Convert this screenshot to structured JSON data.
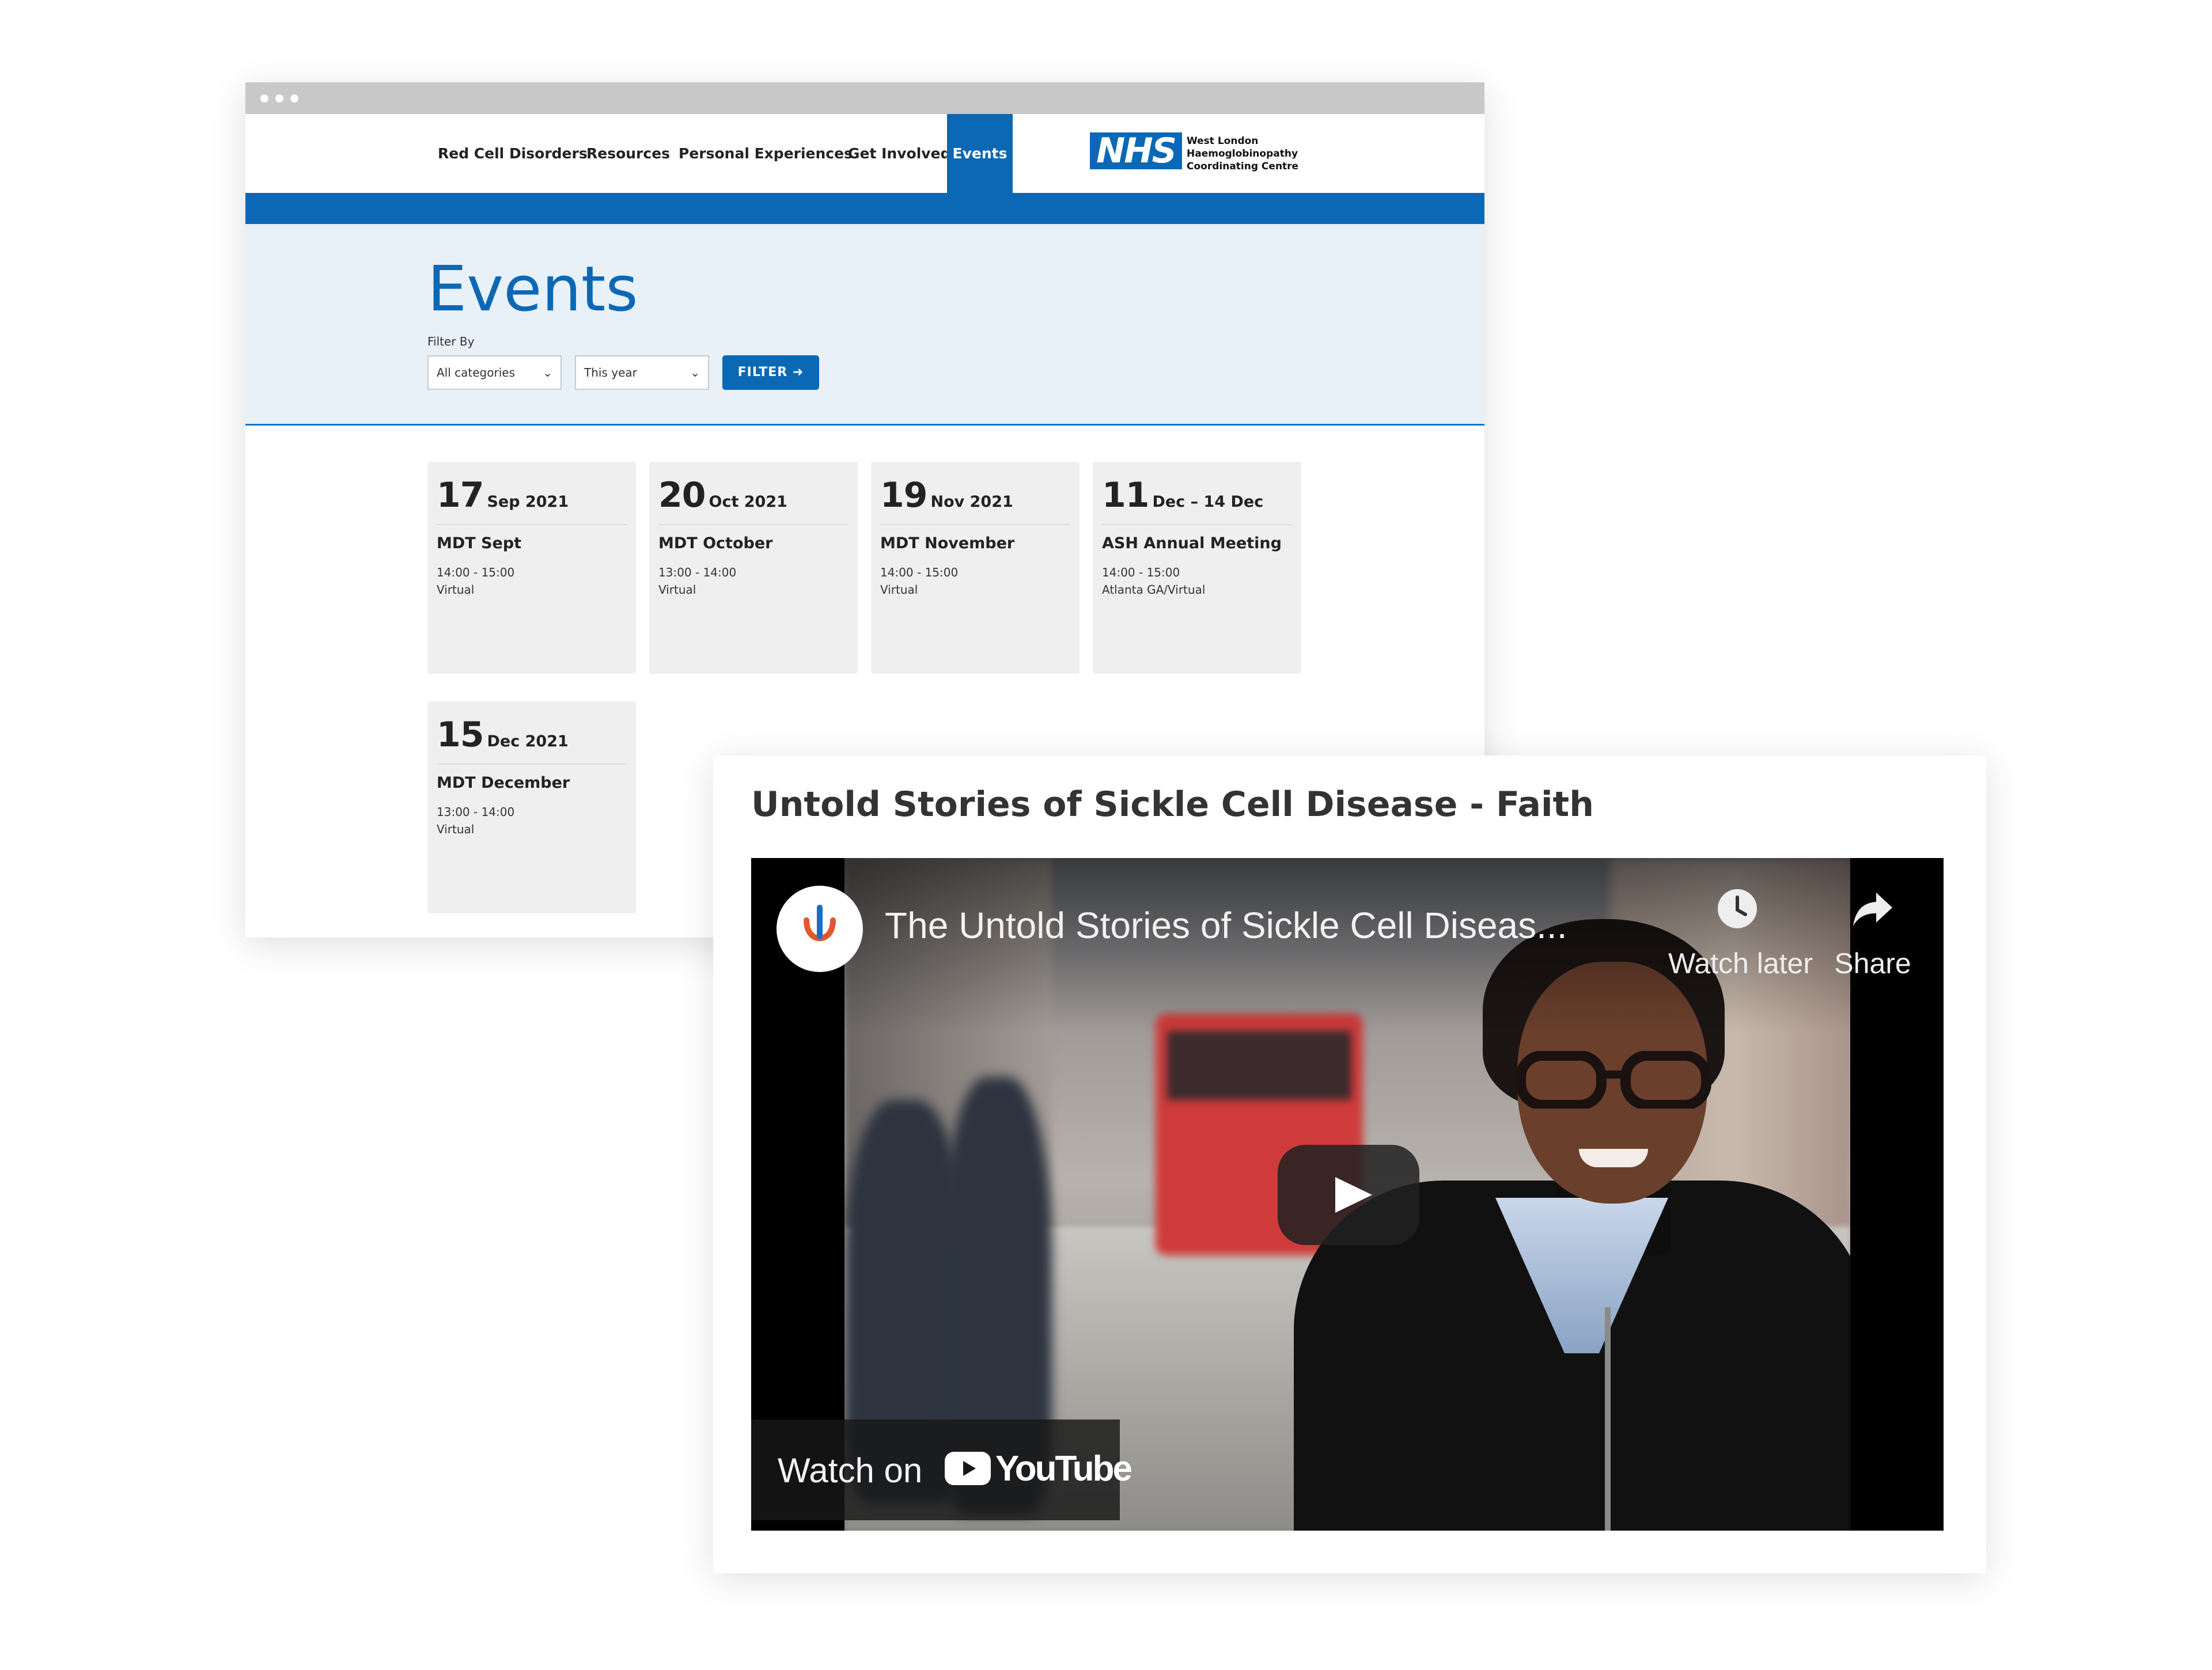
{
  "nav": {
    "items": [
      {
        "label": "Red Cell Disorders"
      },
      {
        "label": "Resources"
      },
      {
        "label": "Personal Experiences"
      },
      {
        "label": "Get Involved"
      },
      {
        "label": "Events",
        "active": true
      }
    ],
    "logo_text": "NHS",
    "org_lines": [
      "West London",
      "Haemoglobinopathy",
      "Coordinating Centre"
    ]
  },
  "hero": {
    "title": "Events",
    "filter_label": "Filter By",
    "category_select": "All categories",
    "period_select": "This year",
    "filter_button": "FILTER"
  },
  "events": [
    {
      "day": "17",
      "month": "Sep 2021",
      "title": "MDT Sept",
      "time": "14:00 - 15:00",
      "location": "Virtual"
    },
    {
      "day": "20",
      "month": "Oct 2021",
      "title": "MDT October",
      "time": "13:00 - 14:00",
      "location": "Virtual"
    },
    {
      "day": "19",
      "month": "Nov 2021",
      "title": "MDT November",
      "time": "14:00 - 15:00",
      "location": "Virtual"
    },
    {
      "day": "11",
      "month": "Dec – 14 Dec",
      "title": "ASH Annual Meeting",
      "time": "14:00 - 15:00",
      "location": "Atlanta GA/Virtual"
    },
    {
      "day": "15",
      "month": "Dec 2021",
      "title": "MDT December",
      "time": "13:00 - 14:00",
      "location": "Virtual"
    }
  ],
  "video": {
    "heading": "Untold Stories of Sickle Cell Disease - Faith",
    "player_title": "The Untold Stories of Sickle Cell Diseas...",
    "watch_later": "Watch later",
    "share": "Share",
    "watch_on": "Watch on",
    "youtube": "YouTube"
  },
  "colors": {
    "nhs_blue": "#0a68b5",
    "hero_bg": "#e8f0f8",
    "card_bg": "#efefef"
  },
  "icons": [
    "chevron-down-icon",
    "arrow-right-icon",
    "clock-icon",
    "share-icon",
    "play-icon",
    "youtube-icon"
  ]
}
